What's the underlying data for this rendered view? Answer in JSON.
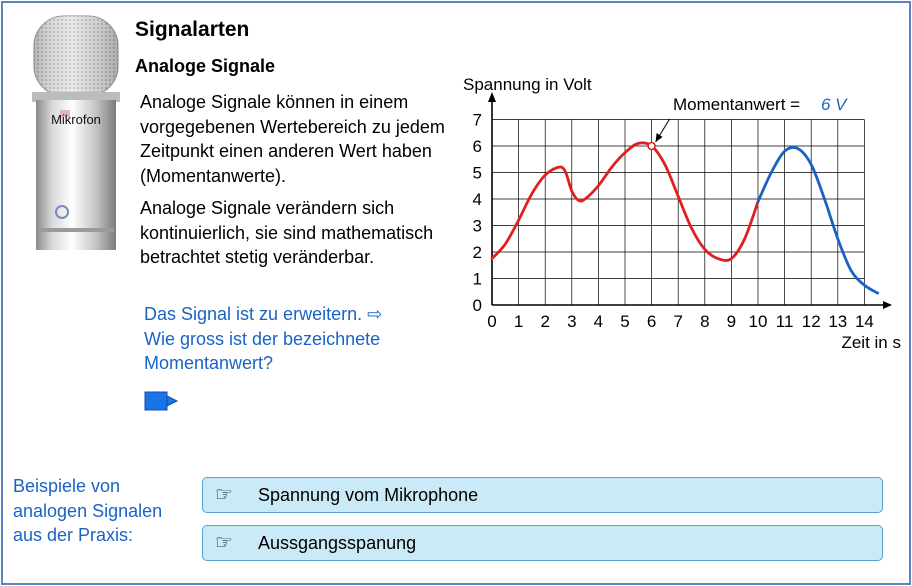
{
  "title": "Signalarten",
  "subtitle": "Analoge Signale",
  "microphone_label": "Mikrofon",
  "paragraph1": "Analoge Signale können in einem vorgegebenen Wertebereich zu jedem Zeitpunkt einen anderen Wert haben (Momentanwerte).",
  "paragraph2": "Analoge Signale verändern sich kontinuierlich, sie sind mathematisch betrachtet stetig veränderbar.",
  "prompt_line1": "Das Signal ist zu erweitern. ⇨",
  "prompt_line2": "Wie gross ist der bezeichnete Momentanwert?",
  "next_icon": "arrow-right-icon",
  "examples_label": "Beispiele von analogen Signalen aus der Praxis:",
  "examples": [
    {
      "icon": "pointing-hand-icon",
      "glyph": "☞",
      "label": "Spannung vom Mikrophone"
    },
    {
      "icon": "pointing-hand-icon",
      "glyph": "☞",
      "label": "Aussgangsspanung"
    }
  ],
  "colors": {
    "accent_blue": "#1a63c4",
    "curve_red": "#e02020",
    "curve_blue": "#1a63c4",
    "button_bg": "#cbeaf7",
    "frame": "#5b84c4"
  },
  "chart_data": {
    "type": "line",
    "ylabel": "Spannung in Volt",
    "xlabel": "Zeit in s",
    "xlim": [
      0,
      14
    ],
    "ylim": [
      0,
      7
    ],
    "x_ticks": [
      "0",
      "1",
      "2",
      "3",
      "4",
      "5",
      "6",
      "7",
      "8",
      "9",
      "10",
      "11",
      "12",
      "13",
      "14"
    ],
    "y_ticks": [
      "0",
      "1",
      "2",
      "3",
      "4",
      "5",
      "6",
      "7"
    ],
    "grid": true,
    "annotation": {
      "text": "Momentanwert = ",
      "value_text": "6 V",
      "x": 6,
      "y": 6
    },
    "series": [
      {
        "color": "#e02020",
        "x": [
          0,
          0.5,
          1,
          1.5,
          2,
          2.5,
          2.75,
          3,
          3.25,
          3.5,
          4,
          4.5,
          5,
          5.5,
          6,
          6.5,
          7,
          7.5,
          8,
          8.5,
          9,
          9.5,
          10
        ],
        "y": [
          1.75,
          2.3,
          3.2,
          4.2,
          4.9,
          5.2,
          5.05,
          4.3,
          3.95,
          4.0,
          4.5,
          5.2,
          5.75,
          6.1,
          6.0,
          5.3,
          4.1,
          2.9,
          2.1,
          1.75,
          1.75,
          2.5,
          3.9
        ]
      },
      {
        "color": "#1a63c4",
        "x": [
          10,
          10.5,
          11,
          11.5,
          12,
          12.5,
          13,
          13.5,
          14,
          14.5
        ],
        "y": [
          3.9,
          5.0,
          5.8,
          5.9,
          5.3,
          4.0,
          2.5,
          1.3,
          0.75,
          0.45
        ]
      }
    ]
  }
}
